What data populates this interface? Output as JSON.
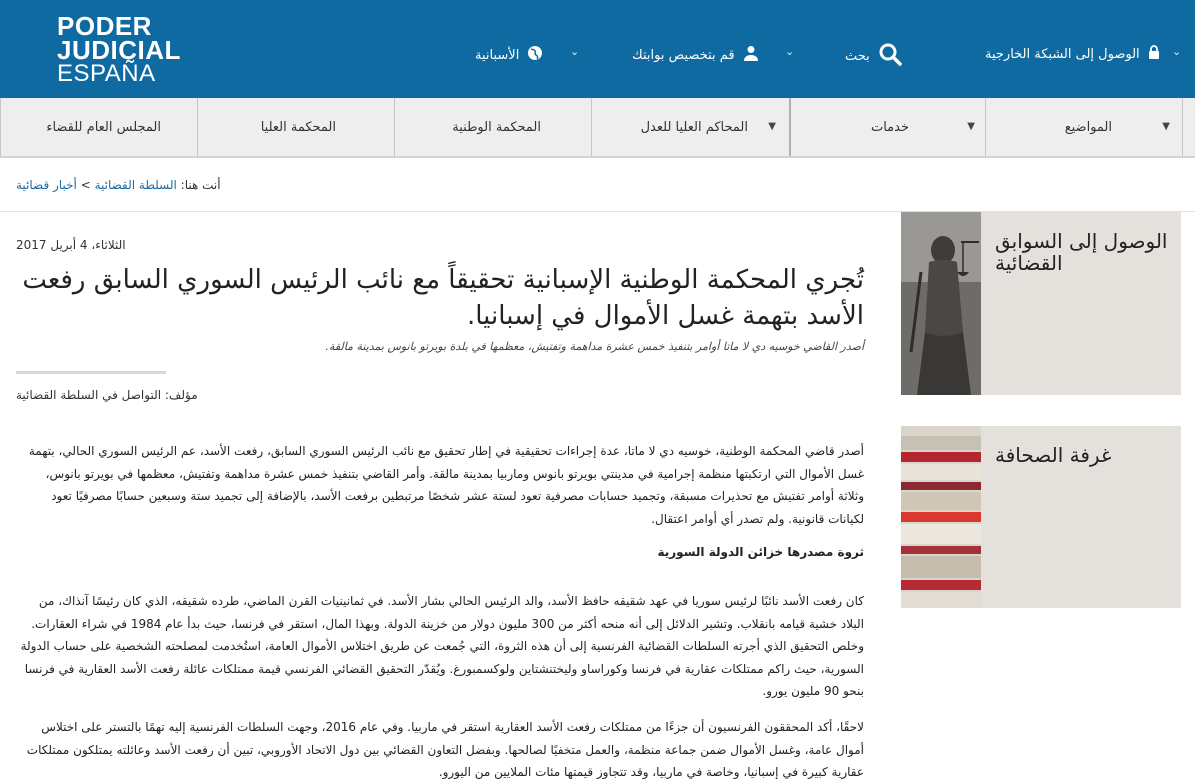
{
  "header": {
    "logo": {
      "line1": "PODER",
      "line2": "JUDICIAL",
      "line3": "ESPAÑA"
    },
    "items": [
      {
        "label": "الوصول إلى الشبكة الخارجية",
        "icon": "lock-icon"
      },
      {
        "label": "بحث",
        "icon": "search-icon"
      },
      {
        "label": "قم بتخصيص بوابتك",
        "icon": "user-icon"
      },
      {
        "label": "الأسبانية",
        "icon": "globe-icon"
      }
    ]
  },
  "nav": {
    "items": [
      {
        "label": "المواضيع"
      },
      {
        "label": "خدمات"
      },
      {
        "label": "المحاكم العليا للعدل"
      },
      {
        "label": "المحكمة الوطنية"
      },
      {
        "label": "المحكمة العليا"
      },
      {
        "label": "المجلس العام للقضاء"
      }
    ]
  },
  "breadcrumb": {
    "prefix": "أنت هنا:",
    "link1": "السلطة القضائية",
    "sep": ">",
    "link2": "أخبار قضائية"
  },
  "article": {
    "date": "الثلاثاء، 4 أبريل 2017",
    "title": "تُجري المحكمة الوطنية الإسبانية تحقيقاً مع نائب الرئيس السوري السابق رفعت الأسد بتهمة غسل الأموال في إسبانيا.",
    "subtitle": "أصدر القاضي خوسيه دي لا ماتا أوامر بتنفيذ خمس عشرة مداهمة وتفتيش، معظمها في بلدة بويرتو بانوس بمدينة مالقة.",
    "author": "مؤلف: التواصل في السلطة القضائية",
    "para1": "أصدر قاضي المحكمة الوطنية، خوسيه دي لا ماتا، عدة إجراءات تحقيقية في إطار تحقيق مع نائب الرئيس السوري السابق، رفعت الأسد، عم الرئيس السوري الحالي، بتهمة غسل الأموال التي ارتكبتها منظمة إجرامية في مدينتي بويرتو بانوس وماربيا بمدينة مالقة. وأمر القاضي بتنفيذ خمس عشرة مداهمة وتفتيش، معظمها في بويرتو بانوس، وثلاثة أوامر تفتيش مع تحذيرات مسبقة، وتجميد حسابات مصرفية تعود لستة عشر شخصًا مرتبطين برفعت الأسد، بالإضافة إلى تجميد ستة وسبعين حسابًا مصرفيًا تعود لكيانات قانونية. ولم تصدر أي أوامر اعتقال.",
    "section_heading": "ثروة مصدرها خزائن الدولة السورية",
    "para2": "كان رفعت الأسد نائبًا لرئيس سوريا في عهد شقيقه حافظ الأسد، والد الرئيس الحالي بشار الأسد. في ثمانينيات القرن الماضي، طرده شقيقه، الذي كان رئيسًا آنذاك، من البلاد خشية قيامه بانقلاب. وتشير الدلائل إلى أنه منحه أكثر من 300 مليون دولار من خزينة الدولة. وبهذا المال، استقر في فرنسا، حيث بدأ عام 1984 في شراء العقارات. وخلص التحقيق الذي أجرته السلطات القضائية الفرنسية إلى أن هذه الثروة، التي جُمعت عن طريق اختلاس الأموال العامة، استُخدمت لمصلحته الشخصية على حساب الدولة السورية، حيث راكم ممتلكات عقارية في فرنسا وكوراساو وليختنشتاين ولوكسمبورغ. ويُقدّر التحقيق القضائي الفرنسي قيمة ممتلكات عائلة رفعت الأسد العقارية في فرنسا بنحو 90 مليون يورو.",
    "para3": "لاحقًا، أكد المحققون الفرنسيون أن جزءًا من ممتلكات رفعت الأسد العقارية استقر في ماربيا. وفي عام 2016، وجهت السلطات الفرنسية إليه تهمًا بالتستر على اختلاس أموال عامة، وغسل الأموال ضمن جماعة منظمة، والعمل متخفيًا لصالحها. وبفضل التعاون القضائي بين دول الاتحاد الأوروبي، تبين أن رفعت الأسد وعائلته يمتلكون ممتلكات عقارية كبيرة في إسبانيا، وخاصة في ماربيا، وقد تتجاوز قيمتها مئات الملايين من اليورو."
  },
  "sidebar": {
    "card1": {
      "title": "الوصول إلى السوابق القضائية"
    },
    "card2": {
      "title": "غرفة الصحافة"
    }
  }
}
